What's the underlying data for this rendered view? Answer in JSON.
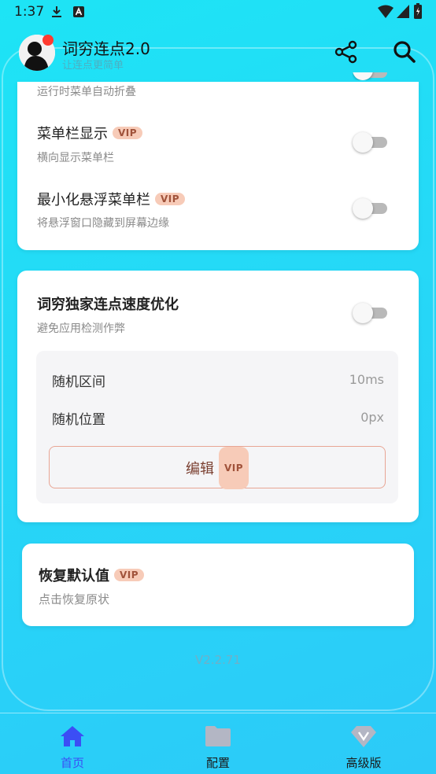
{
  "status_bar": {
    "time": "1:37"
  },
  "header": {
    "title": "词穷连点2.0",
    "subtitle": "让连点更简单",
    "share_icon": "share-icon",
    "search_icon": "search-icon"
  },
  "card1": {
    "rows": [
      {
        "title": "",
        "sub": "运行时菜单自动折叠",
        "vip": false,
        "enabled": false
      },
      {
        "title": "菜单栏显示",
        "sub": "横向显示菜单栏",
        "vip": true,
        "enabled": false
      },
      {
        "title": "最小化悬浮菜单栏",
        "sub": "将悬浮窗口隐藏到屏幕边缘",
        "vip": true,
        "enabled": false
      }
    ]
  },
  "card2": {
    "title": "词穷独家连点速度优化",
    "sub": "避免应用检测作弊",
    "enabled": false,
    "params": [
      {
        "label": "随机区间",
        "value": "10ms"
      },
      {
        "label": "随机位置",
        "value": "0px"
      }
    ],
    "edit_label": "编辑"
  },
  "card3": {
    "title": "恢复默认值",
    "sub": "点击恢复原状"
  },
  "vip_label": "VIP",
  "version": "V2.2.71",
  "nav": [
    {
      "label": "首页",
      "icon": "home-icon",
      "active": true
    },
    {
      "label": "配置",
      "icon": "folder-icon",
      "active": false
    },
    {
      "label": "高级版",
      "icon": "diamond-icon",
      "active": false
    }
  ],
  "colors": {
    "accent": "#3b4ef5",
    "vip_bg": "#f7cbb8",
    "vip_text": "#a0523a",
    "background": "#25d9f7"
  }
}
